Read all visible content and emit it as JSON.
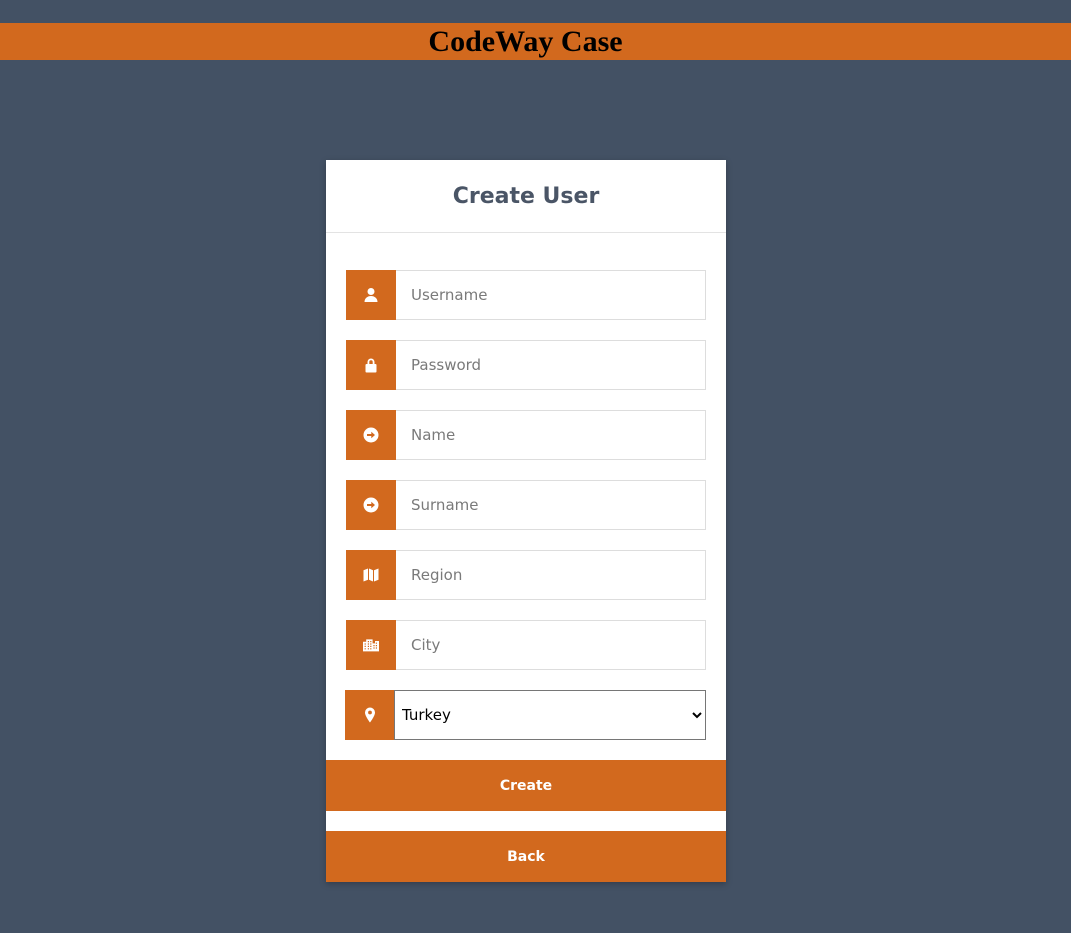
{
  "header": {
    "title": "CodeWay Case"
  },
  "form": {
    "title": "Create User",
    "fields": [
      {
        "placeholder": "Username",
        "value": "",
        "icon": "user-icon"
      },
      {
        "placeholder": "Password",
        "value": "",
        "icon": "lock-icon"
      },
      {
        "placeholder": "Name",
        "value": "",
        "icon": "arrow-circle-right-icon"
      },
      {
        "placeholder": "Surname",
        "value": "",
        "icon": "arrow-circle-right-icon"
      },
      {
        "placeholder": "Region",
        "value": "",
        "icon": "map-icon"
      },
      {
        "placeholder": "City",
        "value": "",
        "icon": "city-icon"
      }
    ],
    "country": {
      "selected": "Turkey",
      "icon": "map-marker-icon"
    },
    "create_label": "Create",
    "back_label": "Back"
  },
  "colors": {
    "page_background": "#435164",
    "accent": "#d2691e",
    "card_background": "#ffffff",
    "title_text": "#4a5566"
  }
}
